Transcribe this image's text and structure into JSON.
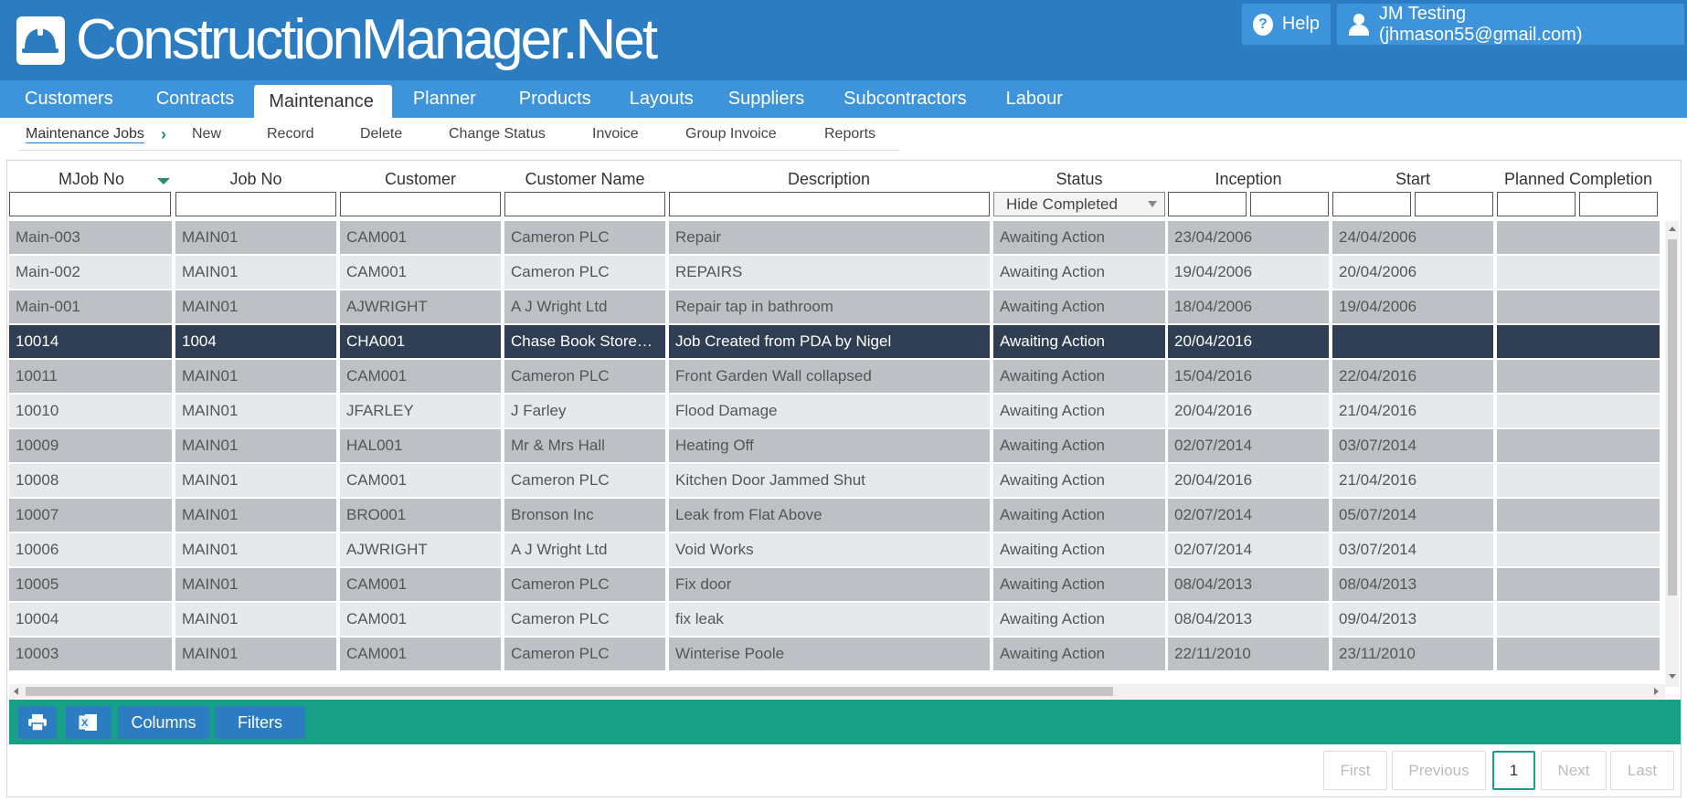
{
  "brand": {
    "title": "ConstructionManager.Net",
    "icon": "hard-hat-icon"
  },
  "header": {
    "help_label": "Help",
    "user_label": "JM Testing (jhmason55@gmail.com)"
  },
  "nav": {
    "tabs": [
      {
        "label": "Customers"
      },
      {
        "label": "Contracts"
      },
      {
        "label": "Maintenance"
      },
      {
        "label": "Planner"
      },
      {
        "label": "Products"
      },
      {
        "label": "Layouts"
      },
      {
        "label": "Suppliers"
      },
      {
        "label": "Subcontractors"
      },
      {
        "label": "Labour"
      }
    ],
    "active": "Maintenance"
  },
  "subnav": {
    "crumb": "Maintenance Jobs",
    "items": [
      {
        "label": "New"
      },
      {
        "label": "Record"
      },
      {
        "label": "Delete"
      },
      {
        "label": "Change Status"
      },
      {
        "label": "Invoice"
      },
      {
        "label": "Group Invoice"
      },
      {
        "label": "Reports"
      }
    ]
  },
  "grid": {
    "columns": [
      {
        "label": "MJob No"
      },
      {
        "label": "Job No"
      },
      {
        "label": "Customer"
      },
      {
        "label": "Customer Name"
      },
      {
        "label": "Description"
      },
      {
        "label": "Status"
      },
      {
        "label": "Inception"
      },
      {
        "label": "Start"
      },
      {
        "label": "Planned Completion"
      }
    ],
    "status_filter": "Hide Completed",
    "rows": [
      [
        "Main-003",
        "MAIN01",
        "CAM001",
        "Cameron PLC",
        "Repair",
        "Awaiting Action",
        "23/04/2006",
        "24/04/2006",
        ""
      ],
      [
        "Main-002",
        "MAIN01",
        "CAM001",
        "Cameron PLC",
        "REPAIRS",
        "Awaiting Action",
        "19/04/2006",
        "20/04/2006",
        ""
      ],
      [
        "Main-001",
        "MAIN01",
        "AJWRIGHT",
        "A J Wright Ltd",
        "Repair tap in bathroom",
        "Awaiting Action",
        "18/04/2006",
        "19/04/2006",
        ""
      ],
      [
        "10014",
        "1004",
        "CHA001",
        "Chase Book Store…",
        "Job Created from PDA by Nigel",
        "Awaiting Action",
        "20/04/2016",
        "",
        ""
      ],
      [
        "10011",
        "MAIN01",
        "CAM001",
        "Cameron PLC",
        "Front Garden Wall collapsed",
        "Awaiting Action",
        "15/04/2016",
        "22/04/2016",
        ""
      ],
      [
        "10010",
        "MAIN01",
        "JFARLEY",
        "J Farley",
        "Flood Damage",
        "Awaiting Action",
        "20/04/2016",
        "21/04/2016",
        ""
      ],
      [
        "10009",
        "MAIN01",
        "HAL001",
        "Mr & Mrs Hall",
        "Heating Off",
        "Awaiting Action",
        "02/07/2014",
        "03/07/2014",
        ""
      ],
      [
        "10008",
        "MAIN01",
        "CAM001",
        "Cameron PLC",
        "Kitchen Door Jammed Shut",
        "Awaiting Action",
        "20/04/2016",
        "21/04/2016",
        ""
      ],
      [
        "10007",
        "MAIN01",
        "BRO001",
        "Bronson Inc",
        "Leak from Flat Above",
        "Awaiting Action",
        "02/07/2014",
        "05/07/2014",
        ""
      ],
      [
        "10006",
        "MAIN01",
        "AJWRIGHT",
        "A J Wright Ltd",
        "Void Works",
        "Awaiting Action",
        "02/07/2014",
        "03/07/2014",
        ""
      ],
      [
        "10005",
        "MAIN01",
        "CAM001",
        "Cameron PLC",
        "Fix door",
        "Awaiting Action",
        "08/04/2013",
        "08/04/2013",
        ""
      ],
      [
        "10004",
        "MAIN01",
        "CAM001",
        "Cameron PLC",
        "fix leak",
        "Awaiting Action",
        "08/04/2013",
        "09/04/2013",
        ""
      ],
      [
        "10003",
        "MAIN01",
        "CAM001",
        "Cameron PLC",
        "Winterise Poole",
        "Awaiting Action",
        "22/11/2010",
        "23/11/2010",
        ""
      ]
    ],
    "selected_row": 3
  },
  "footer": {
    "print_icon": "printer-icon",
    "excel_icon": "excel-icon",
    "columns_label": "Columns",
    "filters_label": "Filters"
  },
  "pager": {
    "first": "First",
    "previous": "Previous",
    "current": "1",
    "next": "Next",
    "last": "Last"
  },
  "colors": {
    "header_blue": "#2b7cc0",
    "nav_blue": "#3d94da",
    "row_dark": "#bdc1c5",
    "row_light": "#e5e9eb",
    "row_selected": "#2f3e52",
    "footer_green": "#17a085"
  }
}
